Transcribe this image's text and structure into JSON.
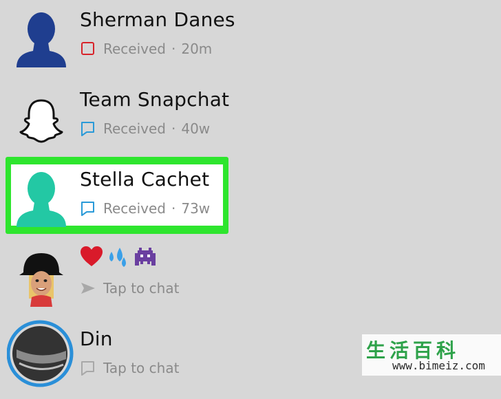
{
  "chats": [
    {
      "name": "Sherman Danes",
      "status": "Received",
      "time": "20m",
      "status_icon": "red-square-snap-icon",
      "avatar": "default-avatar-blue"
    },
    {
      "name": "Team Snapchat",
      "status": "Received",
      "time": "40w",
      "status_icon": "blue-chat-icon",
      "avatar": "ghost-icon"
    },
    {
      "name": "Stella Cachet",
      "status": "Received",
      "time": "73w",
      "status_icon": "blue-chat-icon",
      "avatar": "default-avatar-teal"
    },
    {
      "name_emojis": [
        "❤️",
        "💦",
        "👾"
      ],
      "status": "Tap to chat",
      "status_icon": "gray-send-arrow-icon",
      "avatar": "bitmoji-avatar"
    },
    {
      "name": "Din",
      "status": "Tap to chat",
      "status_icon": "gray-chat-icon",
      "avatar": "photo-avatar-with-story-ring"
    }
  ],
  "separator": "·",
  "watermark": {
    "chars": [
      "生",
      "活",
      "百",
      "科"
    ],
    "url": "www.bimeiz.com"
  },
  "colors": {
    "background": "#d7d7d7",
    "highlight": "#2ee52e",
    "avatar_blue": "#1f3e8f",
    "avatar_teal": "#23c8a4",
    "snap_red": "#d8232a",
    "chat_blue": "#2a9ad8",
    "status_gray": "#8a8a8a"
  }
}
